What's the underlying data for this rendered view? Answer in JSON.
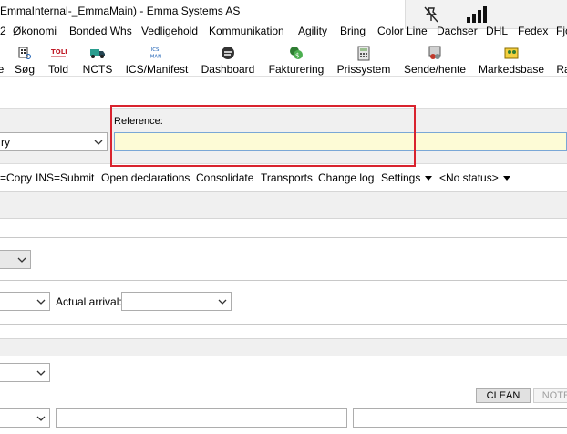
{
  "window": {
    "title": "EmmaInternal-_EmmaMain) - Emma Systems AS"
  },
  "menu": [
    "2",
    "Økonomi",
    "Bonded Whs",
    "Vedligehold",
    "Kommunikation",
    "Agility",
    "Bring",
    "Color Line",
    "Dachser",
    "DHL",
    "Fedex",
    "Fjo"
  ],
  "toolbar": {
    "items": [
      {
        "label": "e",
        "icon": "partial-icon"
      },
      {
        "label": "Søg",
        "icon": "search-building-icon"
      },
      {
        "label": "Told",
        "icon": "told-icon",
        "icon_text": "TOLD"
      },
      {
        "label": "NCTS",
        "icon": "truck-icon"
      },
      {
        "label": "ICS/Manifest",
        "icon": "ics-man-icon",
        "icon_text": "ICS MAN"
      },
      {
        "label": "Dashboard",
        "icon": "dashboard-icon"
      },
      {
        "label": "Fakturering",
        "icon": "invoice-icon"
      },
      {
        "label": "Prissystem",
        "icon": "calculator-icon"
      },
      {
        "label": "Sende/hente",
        "icon": "send-receive-icon"
      },
      {
        "label": "Markedsbase",
        "icon": "market-base-icon"
      },
      {
        "label": "Ra",
        "icon": "partial-icon"
      }
    ]
  },
  "filter": {
    "type_value": "ry",
    "reference_label": "Reference:",
    "reference_value": ""
  },
  "actions": {
    "copy": "=Copy",
    "submit": "INS=Submit",
    "open_declarations": "Open declarations",
    "consolidate": "Consolidate",
    "transports": "Transports",
    "change_log": "Change log",
    "settings": "Settings",
    "status": "<No status>"
  },
  "form": {
    "actual_arrival_label": "Actual arrival:",
    "clean_button": "CLEAN",
    "note_button": "NOTE"
  },
  "colors": {
    "highlight": "#d9232e",
    "reference_bg": "#fdfbd6"
  }
}
